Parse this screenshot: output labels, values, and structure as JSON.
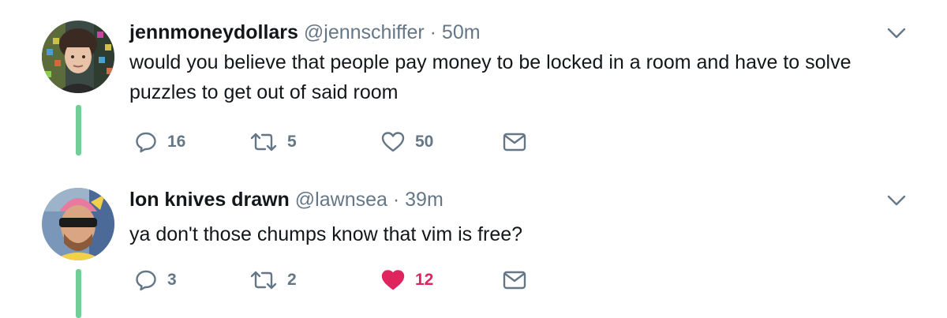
{
  "tweets": [
    {
      "display_name": "jennmoneydollars",
      "handle": "@jennschiffer",
      "separator": "·",
      "time": "50m",
      "text": "would you believe that people pay money to be locked in a room and have to solve puzzles to get out of said room",
      "replies": "16",
      "retweets": "5",
      "likes": "50",
      "liked": false
    },
    {
      "display_name": "lon knives drawn",
      "handle": "@lawnsea",
      "separator": "·",
      "time": "39m",
      "text": "ya don't those chumps know that vim is free?",
      "replies": "3",
      "retweets": "2",
      "likes": "12",
      "liked": true
    }
  ],
  "colors": {
    "text": "#14171a",
    "secondary": "#657786",
    "like_active": "#e0245e",
    "thread_line": "#6fcf97"
  }
}
